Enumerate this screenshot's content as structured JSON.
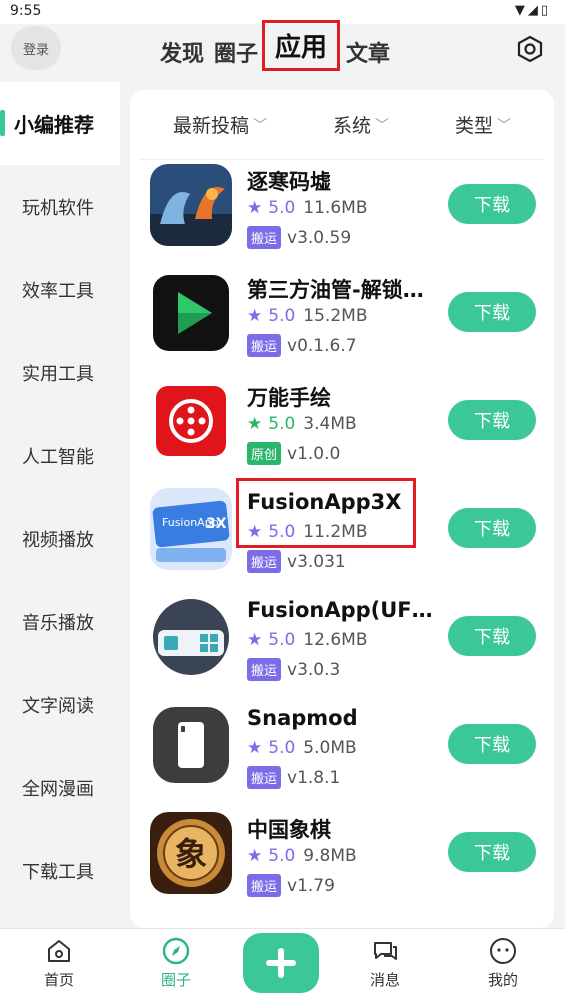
{
  "status_bar": {
    "time": "9:55",
    "icons": "▼◢▯"
  },
  "topbar": {
    "login_label": "登录",
    "tabs": [
      "发现",
      "圈子",
      "应用",
      "文章"
    ],
    "active_tab": "应用"
  },
  "sidebar": {
    "items": [
      "小编推荐",
      "玩机软件",
      "效率工具",
      "实用工具",
      "人工智能",
      "视频播放",
      "音乐播放",
      "文字阅读",
      "全网漫画",
      "下载工具"
    ],
    "active_index": 0
  },
  "filters": [
    "最新投稿",
    "系统",
    "类型"
  ],
  "apps": [
    {
      "name": "逐寒码墟",
      "rating": "5.0",
      "size": "11.6MB",
      "badge": "搬运",
      "badge_color": "#7b6ce8",
      "star_color": "#7b6ce8",
      "version": "v3.0.59",
      "icon": "dragon-phoenix-icon",
      "button": "下载"
    },
    {
      "name": "第三方油管-解锁…",
      "rating": "5.0",
      "size": "15.2MB",
      "badge": "搬运",
      "badge_color": "#7b6ce8",
      "star_color": "#7b6ce8",
      "version": "v0.1.6.7",
      "icon": "play-icon",
      "button": "下载"
    },
    {
      "name": "万能手绘",
      "rating": "5.0",
      "size": "3.4MB",
      "badge": "原创",
      "badge_color": "#2bb56a",
      "star_color": "#2bb56a",
      "version": "v1.0.0",
      "icon": "controller-icon",
      "button": "下载"
    },
    {
      "name": "FusionApp3X",
      "rating": "5.0",
      "size": "11.2MB",
      "badge": "搬运",
      "badge_color": "#7b6ce8",
      "star_color": "#7b6ce8",
      "version": "v3.031",
      "icon": "fusionapp3x-icon",
      "button": "下载"
    },
    {
      "name": "FusionApp(UFO…",
      "rating": "5.0",
      "size": "12.6MB",
      "badge": "搬运",
      "badge_color": "#7b6ce8",
      "star_color": "#7b6ce8",
      "version": "v3.0.3",
      "icon": "fusionapp-ufo-icon",
      "button": "下载"
    },
    {
      "name": "Snapmod",
      "rating": "5.0",
      "size": "5.0MB",
      "badge": "搬运",
      "badge_color": "#7b6ce8",
      "star_color": "#7b6ce8",
      "version": "v1.8.1",
      "icon": "phone-icon",
      "button": "下载"
    },
    {
      "name": "中国象棋",
      "rating": "5.0",
      "size": "9.8MB",
      "badge": "搬运",
      "badge_color": "#7b6ce8",
      "star_color": "#7b6ce8",
      "version": "v1.79",
      "icon": "chess-piece-icon",
      "button": "下载"
    }
  ],
  "bottom_nav": {
    "items": [
      "首页",
      "圈子",
      "消息",
      "我的"
    ],
    "active": "圈子"
  },
  "colors": {
    "accent": "#3cc79b",
    "highlight": "#e01c24"
  }
}
